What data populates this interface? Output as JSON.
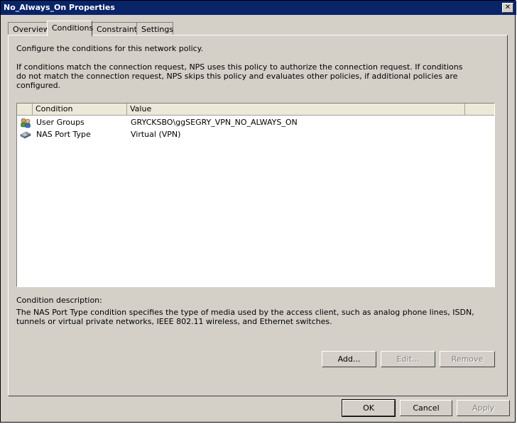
{
  "window": {
    "title": "No_Always_On Properties"
  },
  "tabs": [
    {
      "label": "Overview"
    },
    {
      "label": "Conditions"
    },
    {
      "label": "Constraints"
    },
    {
      "label": "Settings"
    }
  ],
  "conditions": {
    "intro": "Configure the conditions for this network policy.",
    "explanation": "If conditions match the connection request, NPS uses this policy to authorize the connection request. If conditions do not match the connection request, NPS skips this policy and evaluates other policies, if additional policies are configured.",
    "list": {
      "columns": [
        "Condition",
        "Value"
      ],
      "rows": [
        {
          "icon": "user-groups-icon",
          "condition": "User Groups",
          "value": "GRYCKSBO\\ggSEGRY_VPN_NO_ALWAYS_ON"
        },
        {
          "icon": "nas-port-icon",
          "condition": "NAS Port Type",
          "value": "Virtual (VPN)"
        }
      ]
    },
    "description_label": "Condition description:",
    "description": "The NAS Port Type condition specifies the type of media used by the access client, such as analog phone lines, ISDN, tunnels or virtual private networks, IEEE 802.11 wireless, and Ethernet switches.",
    "buttons": {
      "add": "Add...",
      "edit": "Edit...",
      "remove": "Remove"
    }
  },
  "dialog_buttons": {
    "ok": "OK",
    "cancel": "Cancel",
    "apply": "Apply"
  }
}
